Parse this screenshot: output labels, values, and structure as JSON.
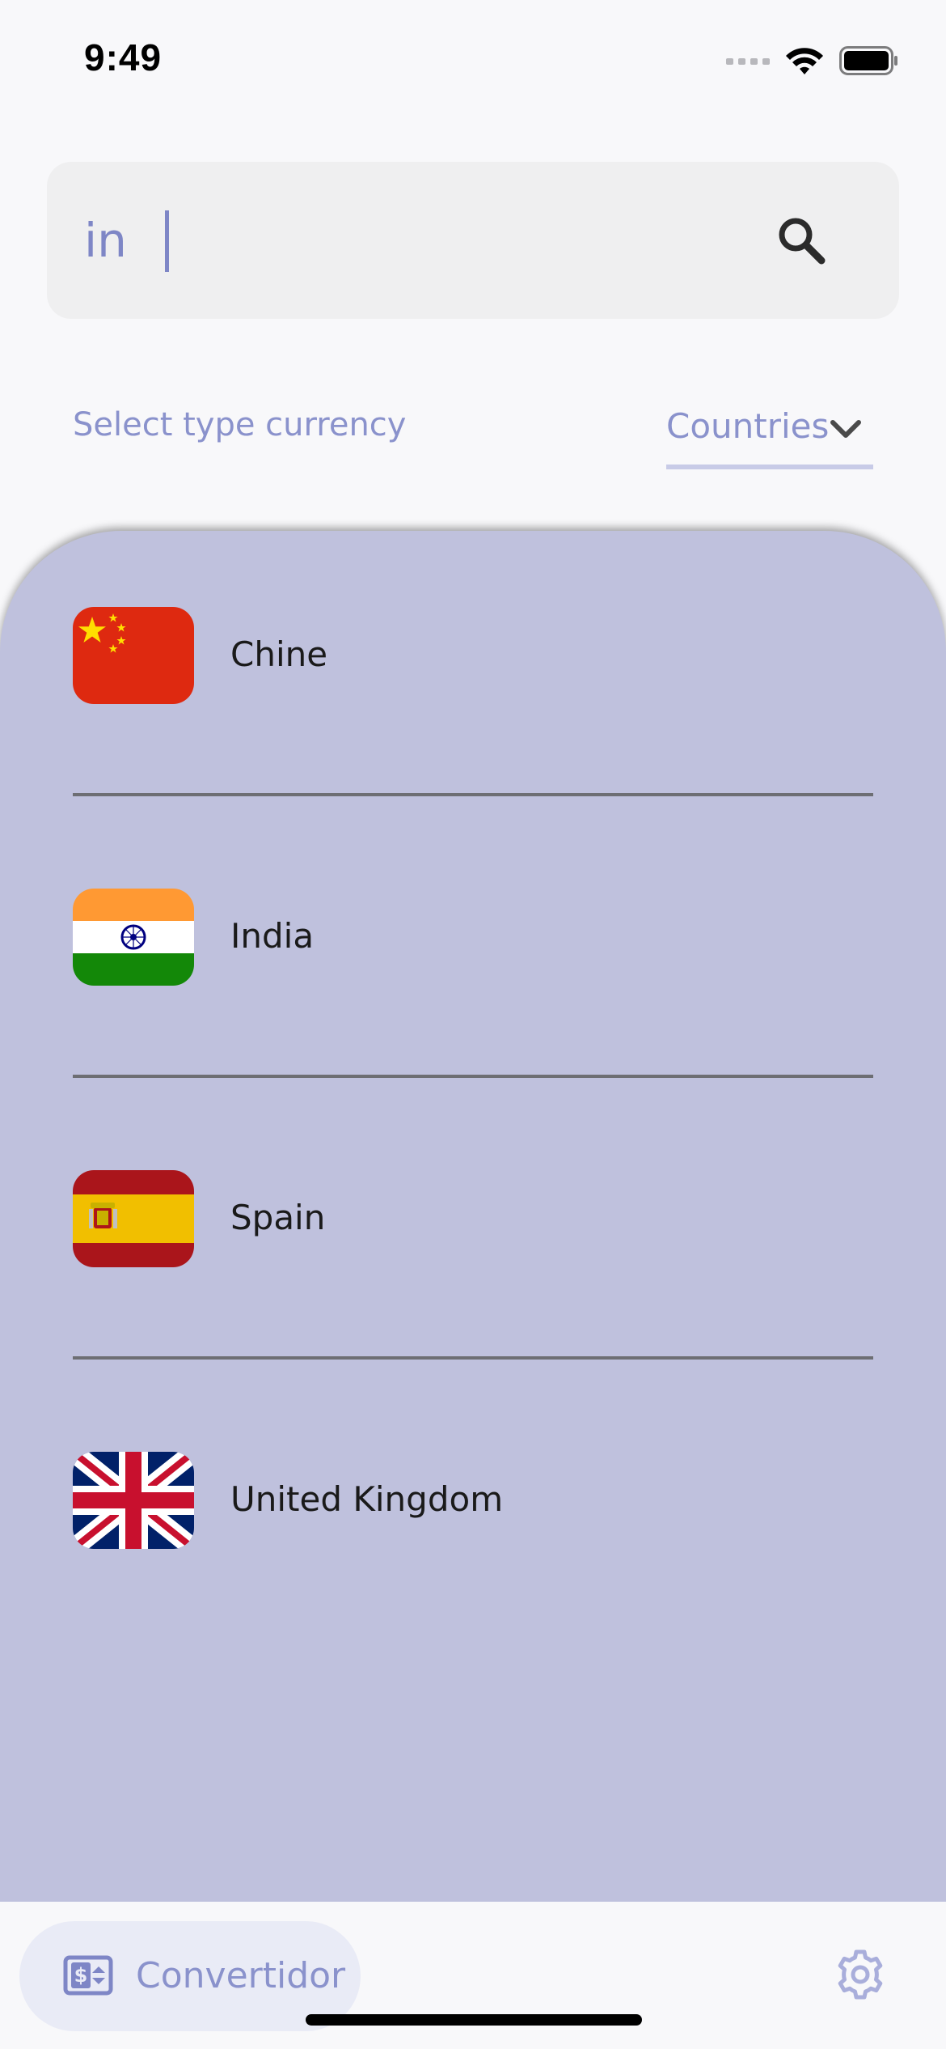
{
  "status_bar": {
    "time": "9:49",
    "icons": [
      "signal-icon",
      "wifi-icon",
      "battery-icon"
    ]
  },
  "search": {
    "value": "in",
    "icon": "search-icon"
  },
  "currency_type": {
    "label": "Select type currency",
    "selected": "Countries",
    "icon": "chevron-down-icon"
  },
  "countries": [
    {
      "name": "Chine",
      "flag": "china-flag-icon"
    },
    {
      "name": "India",
      "flag": "india-flag-icon"
    },
    {
      "name": "Spain",
      "flag": "spain-flag-icon"
    },
    {
      "name": "United Kingdom",
      "flag": "uk-flag-icon"
    }
  ],
  "bottom_nav": {
    "convert_label": "Convertidor",
    "convert_icon": "currency-converter-icon",
    "settings_icon": "gear-icon"
  },
  "colors": {
    "accent": "#8a92cc",
    "panel": "#bfc1dd",
    "search_bg": "#efeff0"
  }
}
